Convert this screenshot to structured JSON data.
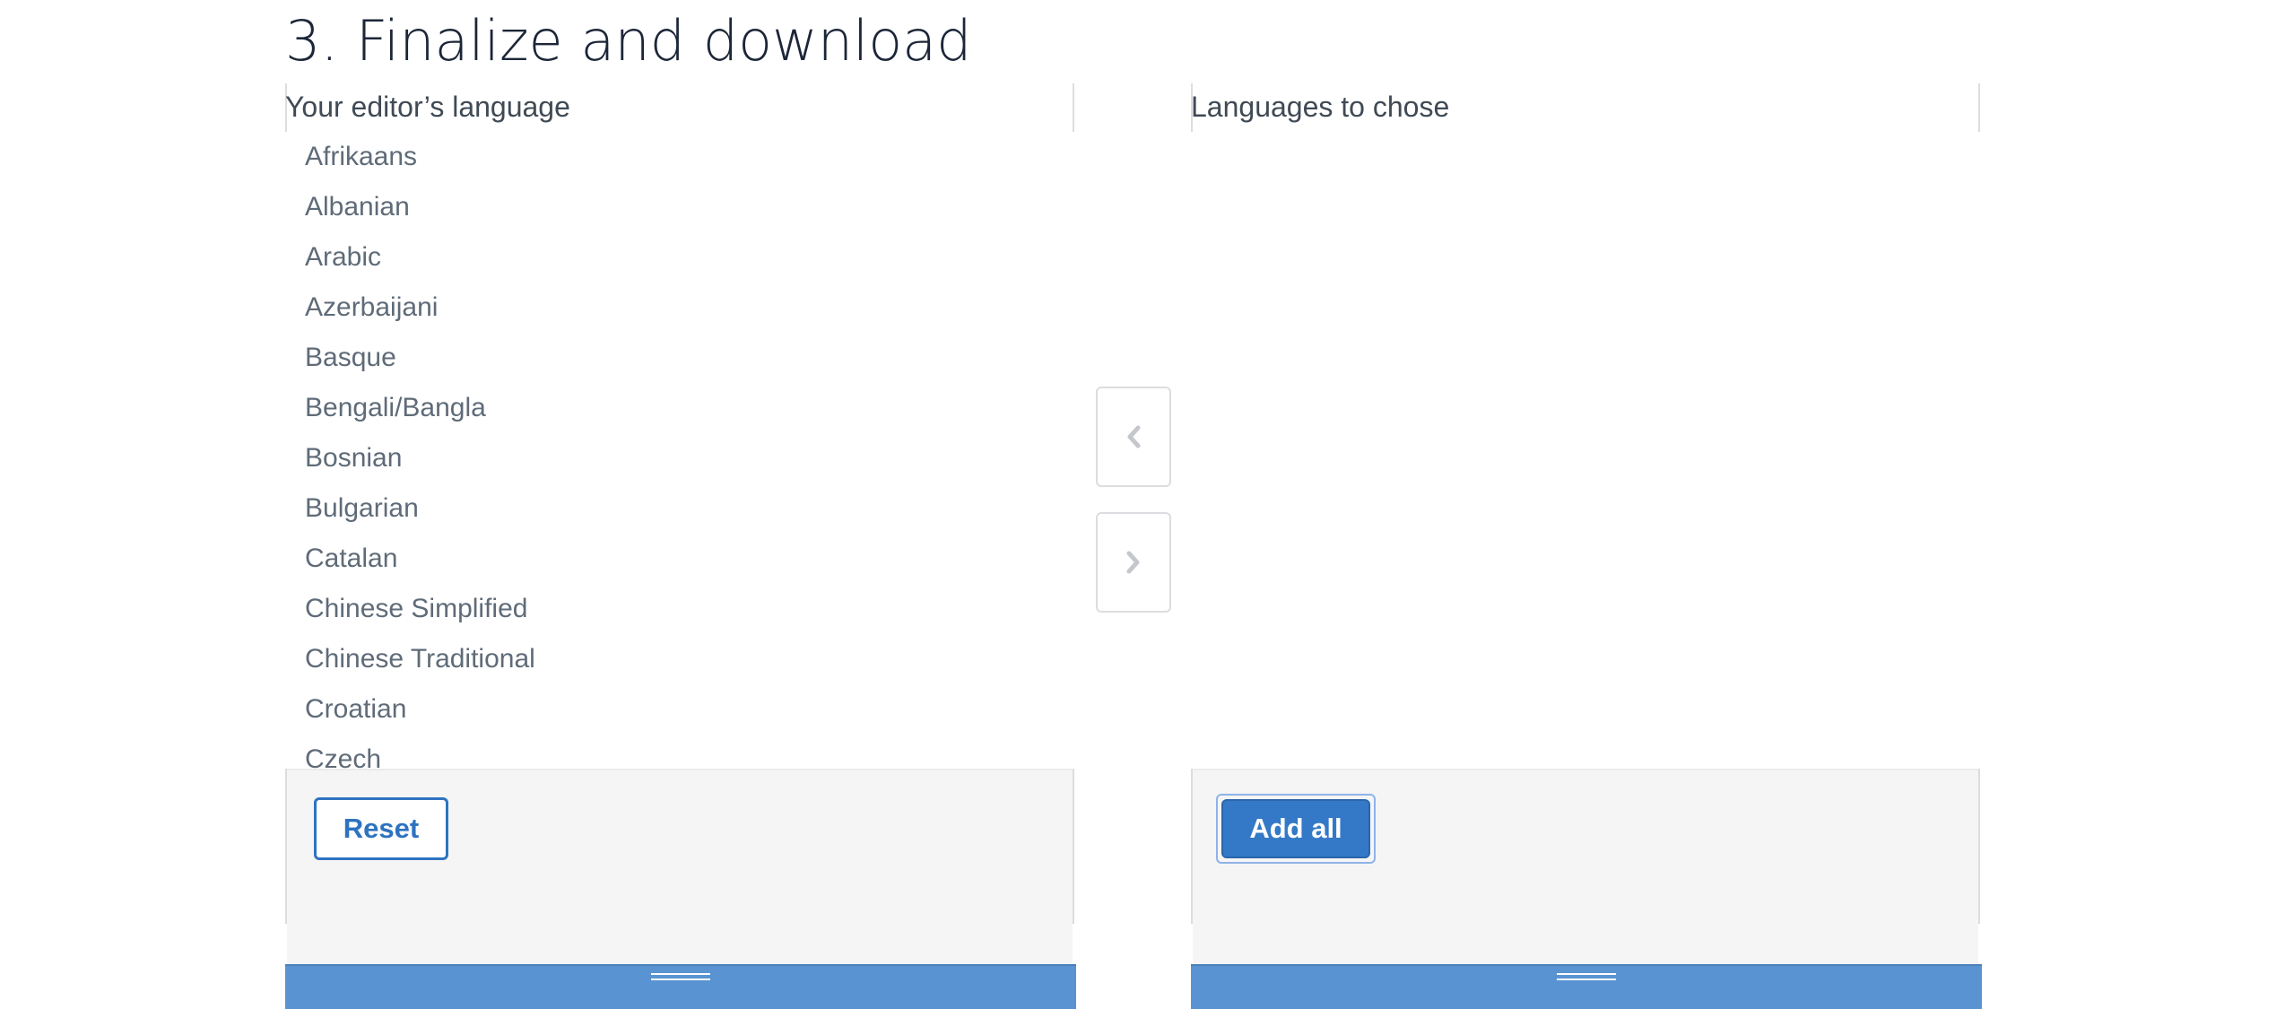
{
  "section": {
    "title": "3. Finalize and download"
  },
  "left_panel": {
    "heading": "Your editor’s language",
    "items": [
      "Afrikaans",
      "Albanian",
      "Arabic",
      "Azerbaijani",
      "Basque",
      "Bengali/Bangla",
      "Bosnian",
      "Bulgarian",
      "Catalan",
      "Chinese Simplified",
      "Chinese Traditional",
      "Croatian",
      "Czech"
    ],
    "reset_label": "Reset"
  },
  "right_panel": {
    "heading": "Languages to chose",
    "items": [],
    "add_all_label": "Add all"
  },
  "controls": {
    "move_left_icon": "chevron-left-icon",
    "move_right_icon": "chevron-right-icon"
  },
  "colors": {
    "primary": "#3479c7",
    "resize_bar": "#5a93d2",
    "icon_gray": "#c4c7cc"
  }
}
